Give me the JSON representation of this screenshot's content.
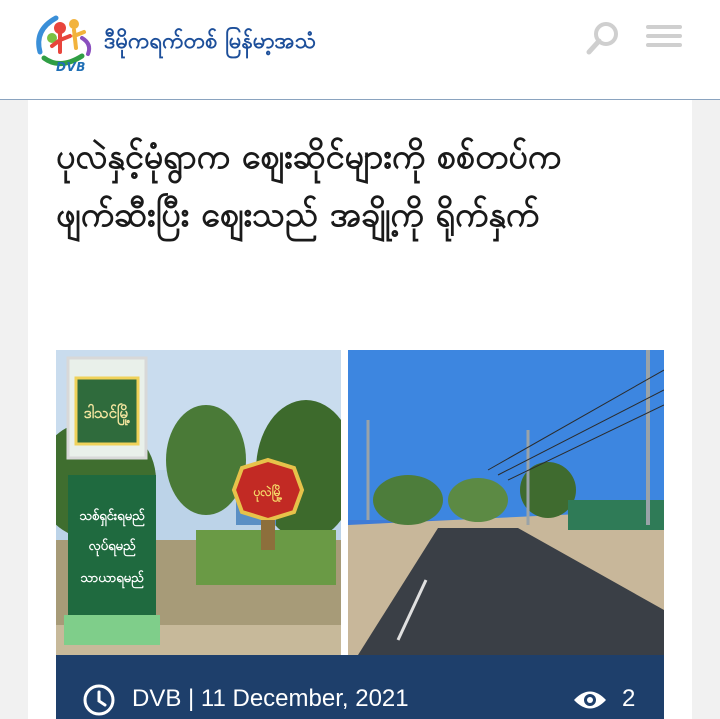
{
  "header": {
    "logo_text": "DVB",
    "brand_name": "ဒီမိုကရက်တစ် မြန်မာ့အသံ",
    "icons": {
      "search": "search-icon",
      "menu": "hamburger-menu-icon"
    }
  },
  "article": {
    "title": "ပုလဲနှင့်မုံရွာက ဈေးဆိုင်များကို စစ်တပ်က ဖျက်ဆီးပြီး ဈေးသည် အချို့ကို ရိုက်နှက်",
    "image_left": {
      "sign_top": "ဒါသင်မြို့",
      "sign_lines": [
        "သစ်ရှင်းရမည်",
        "လုပ်ရမည်",
        "သာယာရမည်"
      ],
      "red_sign": "ပုလဲမြို့"
    },
    "meta": {
      "author_date": "DVB | 11 December, 2021",
      "views": "2",
      "icons": {
        "time": "clock-icon",
        "views": "eye-icon"
      }
    }
  },
  "colors": {
    "brand_blue": "#1d4f9a",
    "meta_bar": "#1e3f6b",
    "header_border": "#8aa3bf"
  }
}
